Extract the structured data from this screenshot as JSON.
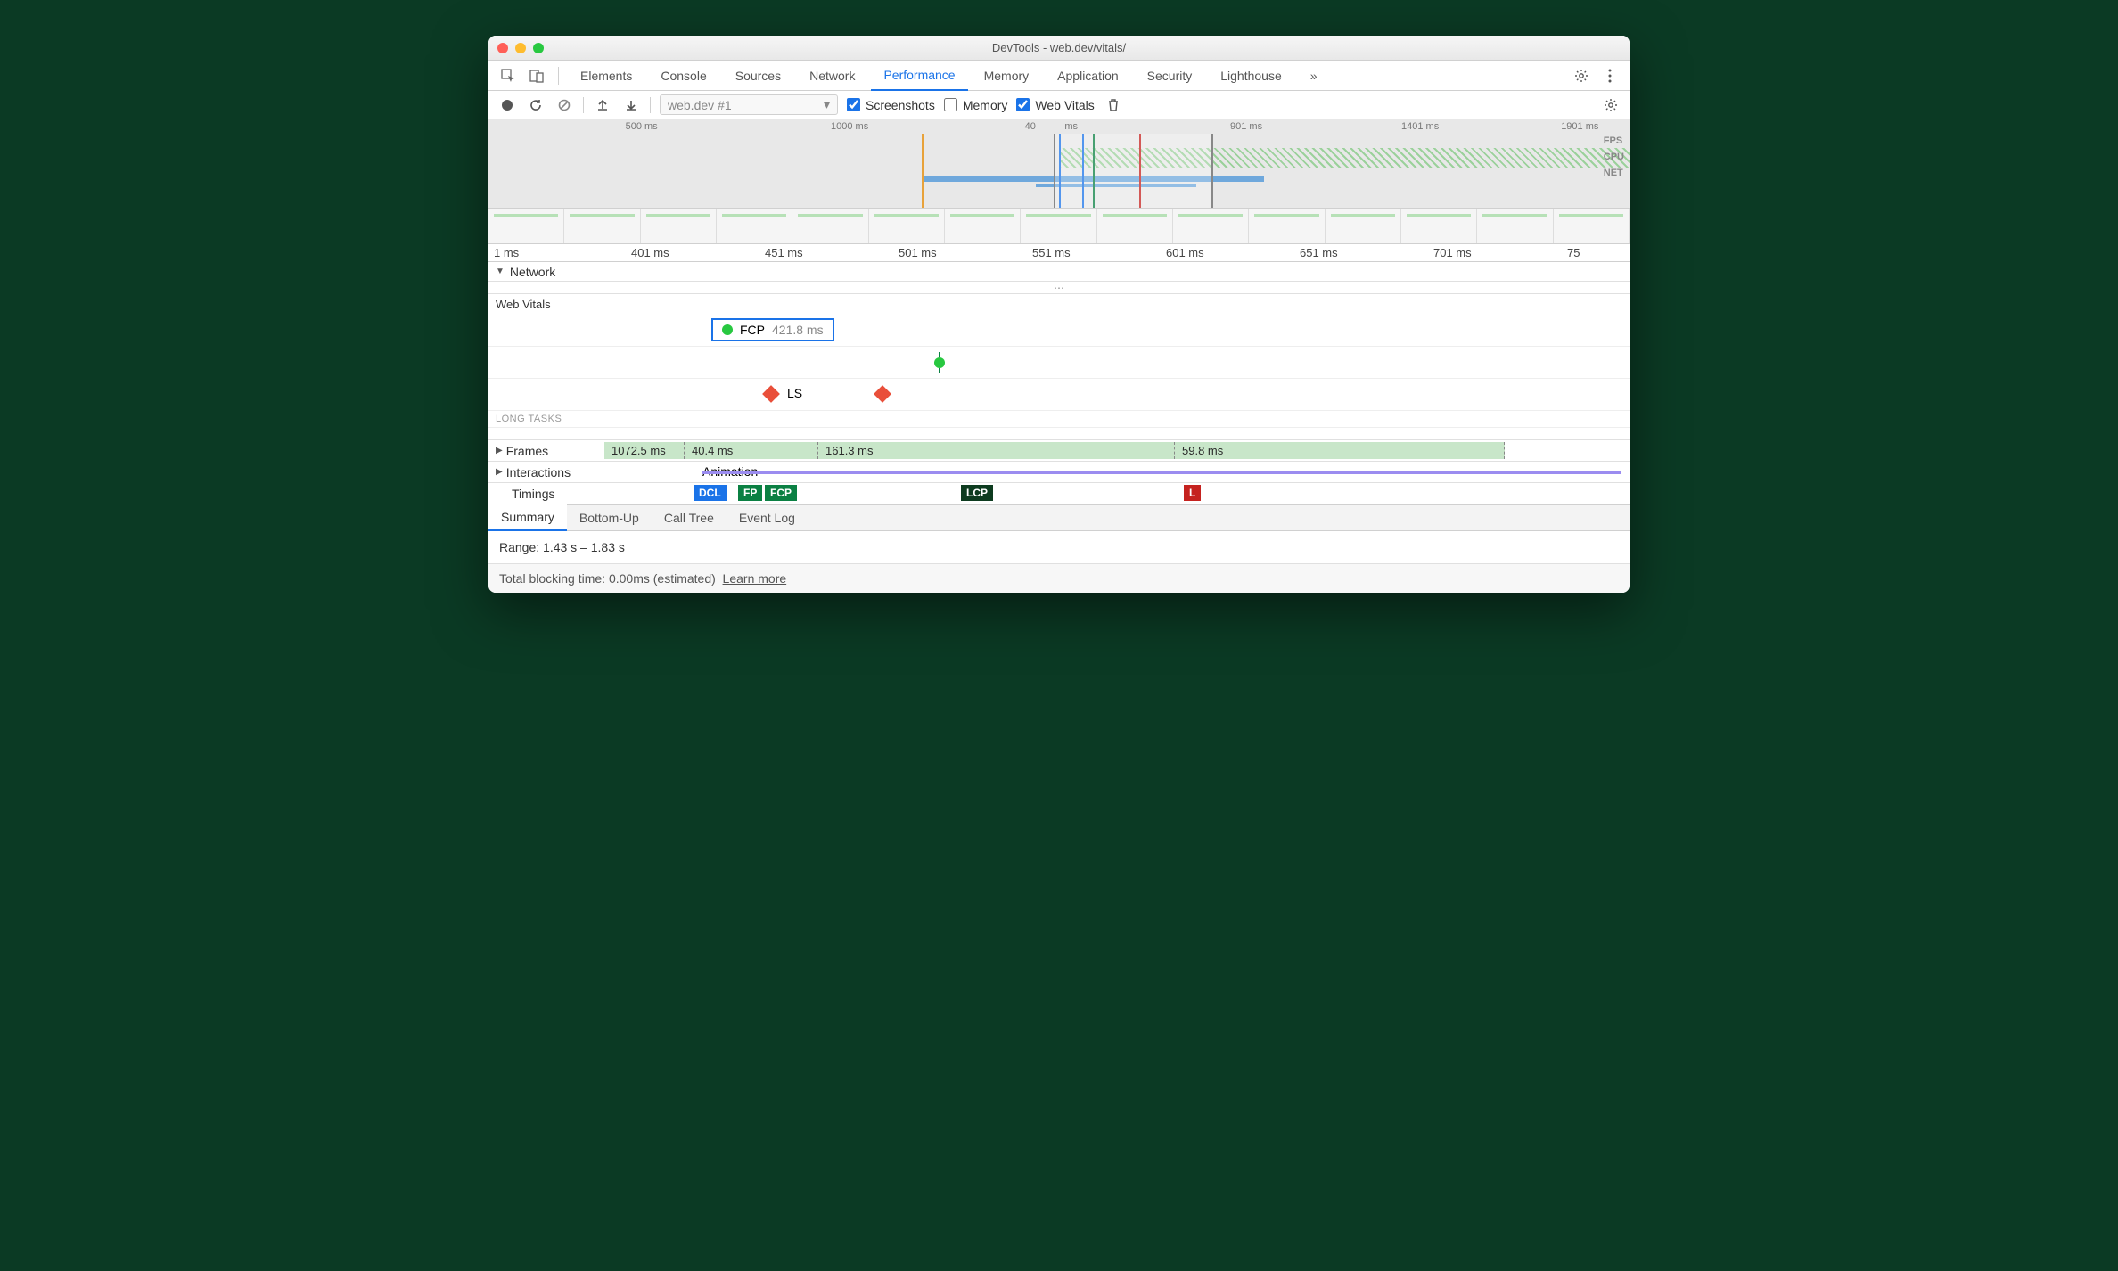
{
  "window": {
    "title": "DevTools - web.dev/vitals/"
  },
  "tabs": {
    "items": [
      "Elements",
      "Console",
      "Sources",
      "Network",
      "Performance",
      "Memory",
      "Application",
      "Security",
      "Lighthouse"
    ],
    "active": "Performance",
    "more": "»"
  },
  "toolbar": {
    "dropdown": "web.dev #1",
    "screenshots": {
      "label": "Screenshots",
      "checked": true
    },
    "memory": {
      "label": "Memory",
      "checked": false
    },
    "webvitals": {
      "label": "Web Vitals",
      "checked": true
    }
  },
  "overview": {
    "ticks": [
      "500 ms",
      "1000 ms",
      "40",
      "ms",
      "901 ms",
      "1401 ms",
      "1901 ms"
    ],
    "labels": {
      "fps": "FPS",
      "cpu": "CPU",
      "net": "NET"
    }
  },
  "ruler2": [
    "1 ms",
    "401 ms",
    "451 ms",
    "501 ms",
    "551 ms",
    "601 ms",
    "651 ms",
    "701 ms",
    "75"
  ],
  "sections": {
    "network": "Network",
    "webvitals": "Web Vitals",
    "longtasks": "LONG TASKS",
    "frames": "Frames",
    "interactions": "Interactions",
    "timings": "Timings"
  },
  "webvitals": {
    "fcp": {
      "name": "FCP",
      "value": "421.8 ms"
    },
    "ls": "LS"
  },
  "frames": {
    "leading": "1072.5 ms",
    "segs": [
      "40.4 ms",
      "161.3 ms",
      "59.8 ms"
    ]
  },
  "interactions": {
    "label": "Animation"
  },
  "timings": {
    "dcl": "DCL",
    "fp": "FP",
    "fcp": "FCP",
    "lcp": "LCP",
    "l": "L"
  },
  "bottom_tabs": {
    "items": [
      "Summary",
      "Bottom-Up",
      "Call Tree",
      "Event Log"
    ],
    "active": "Summary"
  },
  "summary": {
    "range": "Range: 1.43 s – 1.83 s"
  },
  "footer": {
    "tbt": "Total blocking time: 0.00ms (estimated)",
    "learn": "Learn more"
  }
}
